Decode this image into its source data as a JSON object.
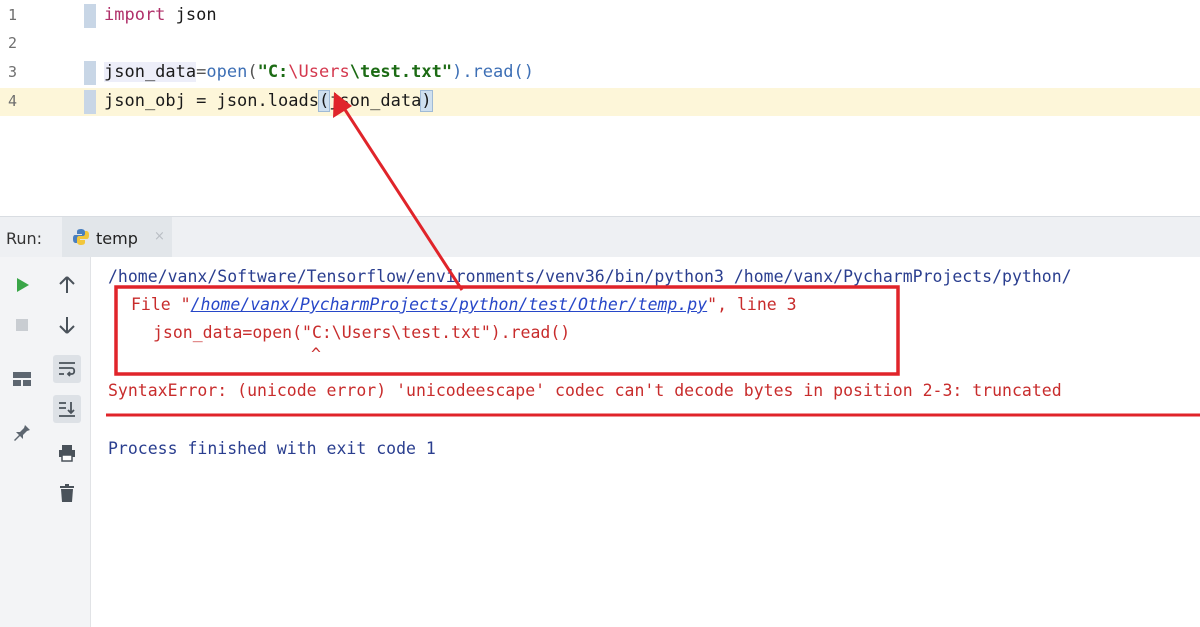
{
  "editor": {
    "lines": [
      {
        "num": "1",
        "text": "import json"
      },
      {
        "num": "2",
        "text": ""
      },
      {
        "num": "3",
        "text": "json_data=open(\"C:\\Users\\test.txt\").read()"
      },
      {
        "num": "4",
        "text": "json_obj = json.loads(json_data)"
      }
    ],
    "tokens": {
      "import_kw": "import",
      "json_mod": " json",
      "ident_json_data": "json_data",
      "eq": "=",
      "open_fn": "open",
      "open_paren": "(",
      "str_q1": "\"C:",
      "str_esc": "\\Users",
      "str_rest": "\\test.txt\"",
      "read_call": ").read()",
      "line4_pre": "json_obj = json.loads",
      "bracket_open": "(",
      "line4_arg": "json_data",
      "bracket_close": ")"
    }
  },
  "run_panel": {
    "label": "Run:",
    "tab_name": "temp",
    "tab_close": "×",
    "console": {
      "cmd_line": "/home/vanx/Software/Tensorflow/environments/venv36/bin/python3 /home/vanx/PycharmProjects/python/",
      "file_prefix": "File \"",
      "file_path": "/home/vanx/PycharmProjects/python/test/Other/temp.py",
      "file_suffix": "\", line 3",
      "code_line": "json_data=open(\"C:\\Users\\test.txt\").read()",
      "caret": "^",
      "error_line": "SyntaxError: (unicode error) 'unicodeescape' codec can't decode bytes in position 2-3: truncated",
      "process_line": "Process finished with exit code 1"
    }
  },
  "colors": {
    "annotation_red": "#e0242a",
    "run_green": "#3aa648",
    "current_line": "#fdf6d9"
  },
  "icons": {
    "left_toolbar": [
      "play-icon",
      "stop-icon",
      "layout-icon",
      "pin-icon"
    ],
    "mid_toolbar": [
      "arrow-up-icon",
      "arrow-down-icon",
      "soft-wrap-icon",
      "scroll-to-end-icon",
      "print-icon",
      "trash-icon"
    ]
  }
}
